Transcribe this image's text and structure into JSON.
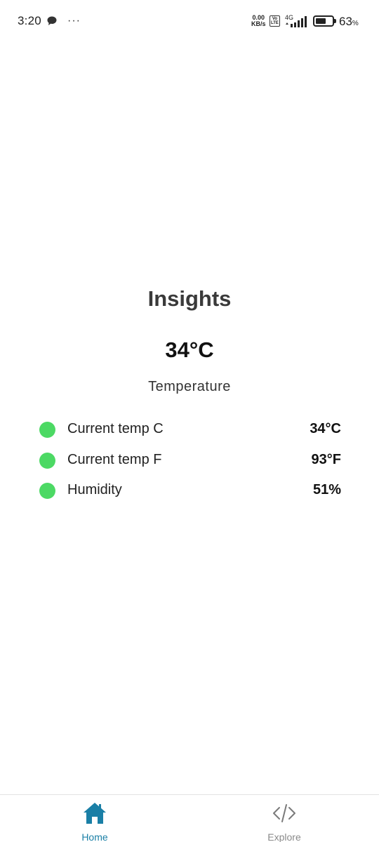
{
  "status_bar": {
    "time": "3:20",
    "net_speed_value": "0.00",
    "net_speed_unit": "KB/s",
    "volte_top": "Vo",
    "volte_bottom": "LTE",
    "network_type": "4G",
    "battery_percent": "63",
    "battery_percent_sign": "%",
    "battery_level": 0.63
  },
  "insights": {
    "title": "Insights",
    "main_value": "34°C",
    "main_label": "Temperature"
  },
  "metrics": [
    {
      "label": "Current temp C",
      "value": "34°C",
      "dot_color": "#4cd964"
    },
    {
      "label": "Current temp F",
      "value": "93°F",
      "dot_color": "#4cd964"
    },
    {
      "label": "Humidity",
      "value": "51%",
      "dot_color": "#4cd964"
    }
  ],
  "nav": {
    "home_label": "Home",
    "explore_label": "Explore",
    "active_color": "#1a7fa6",
    "inactive_color": "#8a8a8a"
  },
  "icons": {
    "chat": "chat-bubble-icon",
    "more": "more-dots-icon",
    "signal": "signal-icon",
    "battery": "battery-icon",
    "home": "home-icon",
    "explore": "code-icon"
  }
}
